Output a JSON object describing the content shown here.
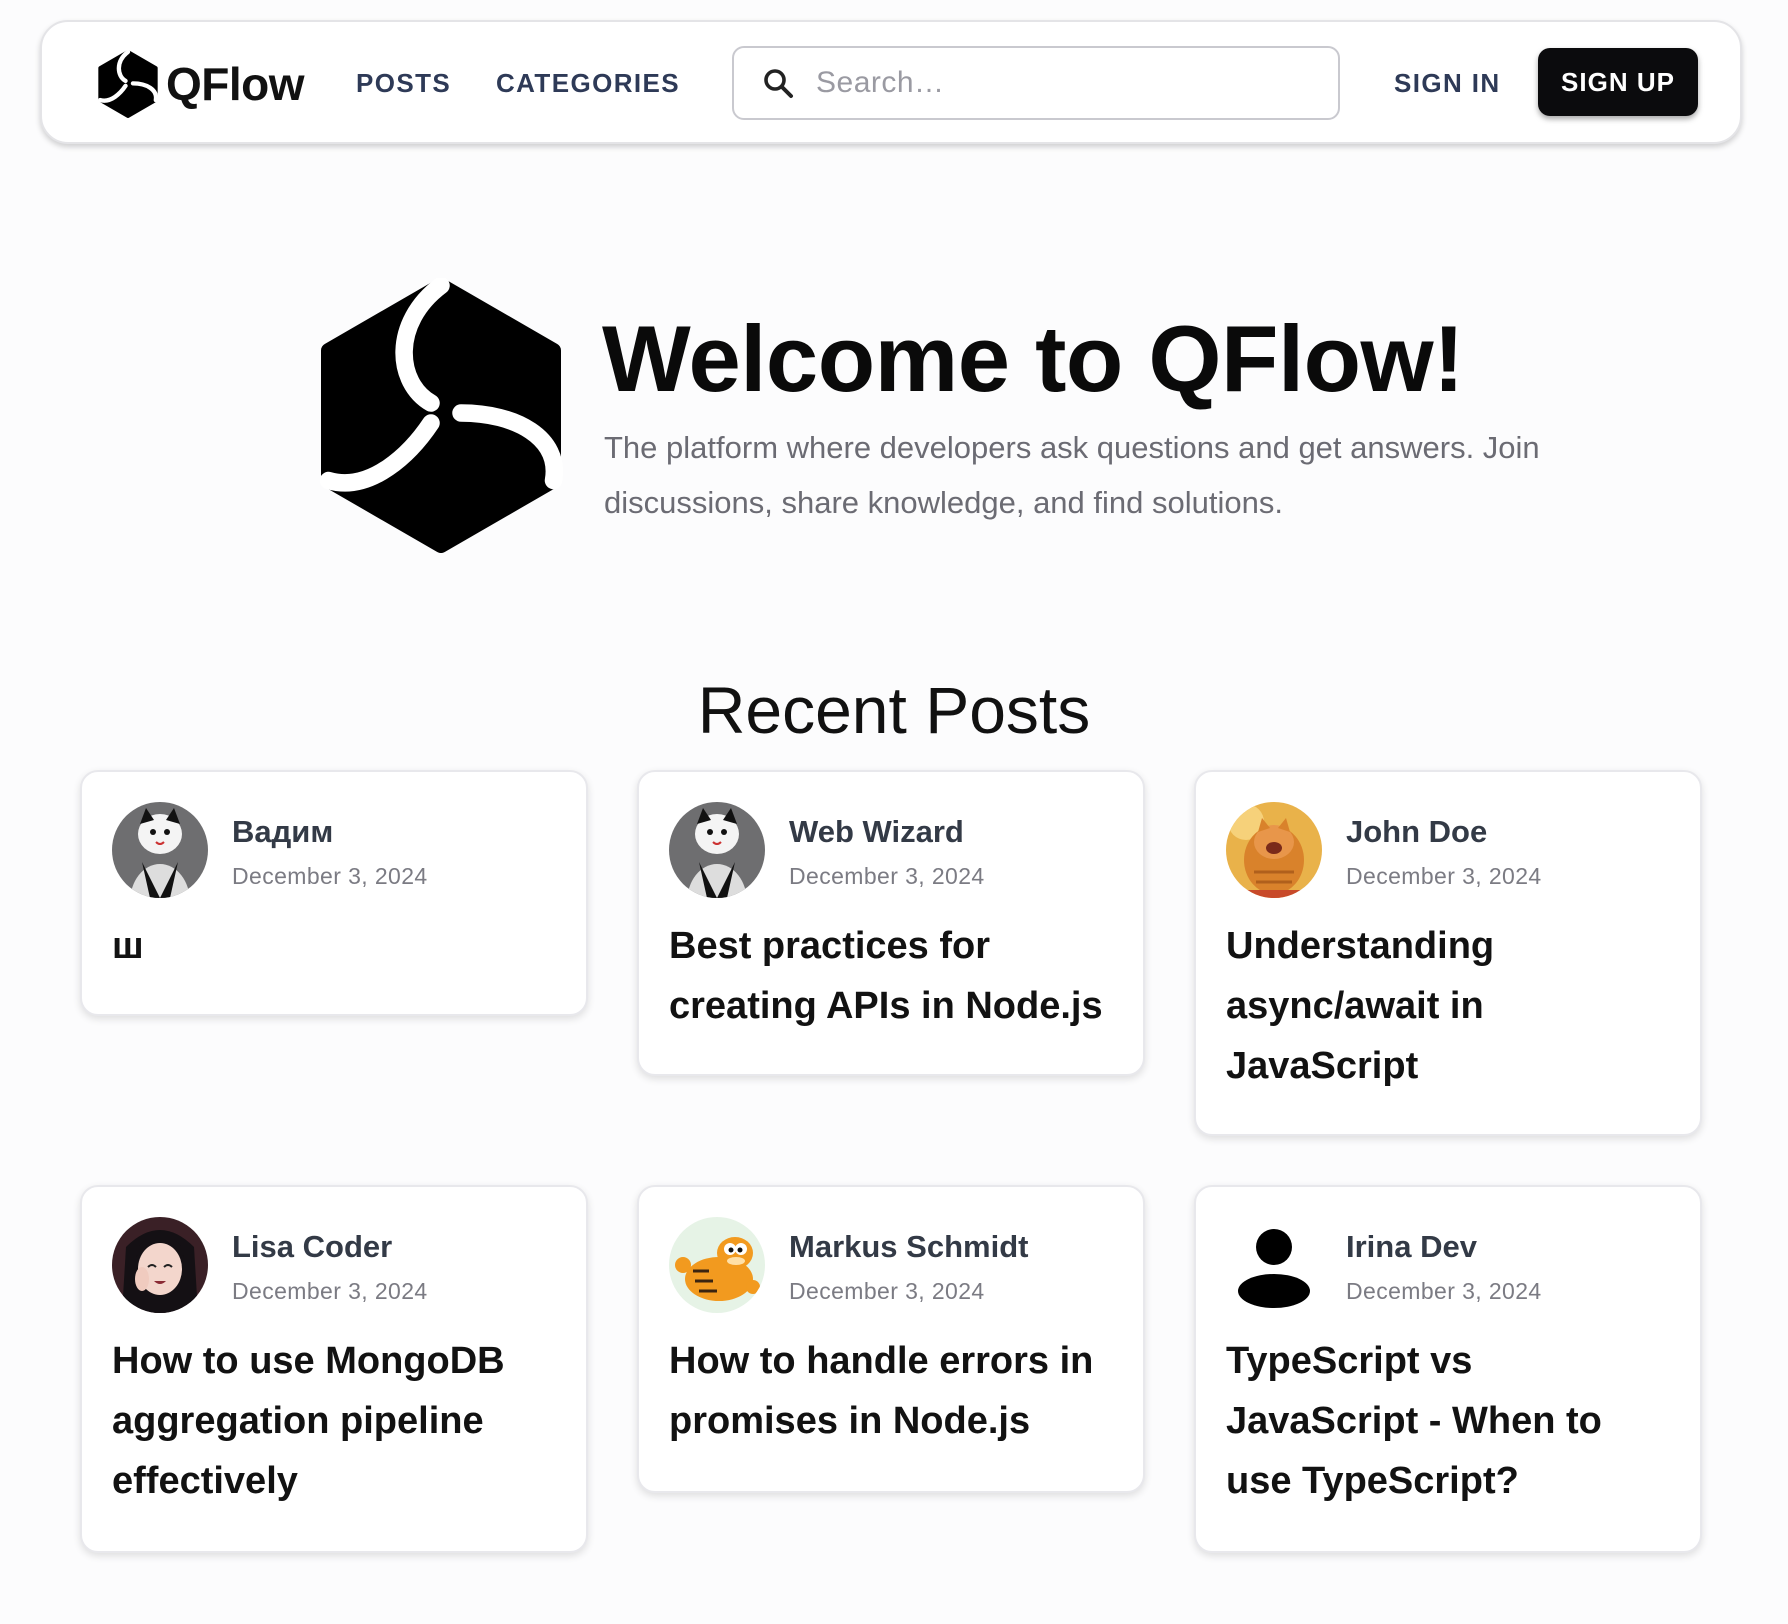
{
  "nav": {
    "brand": "QFlow",
    "links": [
      "Posts",
      "Categories"
    ],
    "search_placeholder": "Search…",
    "sign_in": "SIGN IN",
    "sign_up": "SIGN UP"
  },
  "hero": {
    "title": "Welcome to QFlow!",
    "subtitle": "The platform where developers ask questions and get answers. Join discussions, share knowledge, and find solutions."
  },
  "recent": {
    "title": "Recent Posts",
    "posts": [
      {
        "author": "Вадим",
        "date": "December 3, 2024",
        "title": "ш",
        "avatar": "cat-mask-avatar"
      },
      {
        "author": "Web Wizard",
        "date": "December 3, 2024",
        "title": "Best practices for creating APIs in Node.js",
        "avatar": "cat-mask-avatar"
      },
      {
        "author": "John Doe",
        "date": "December 3, 2024",
        "title": "Understanding async/await in JavaScript",
        "avatar": "orange-cat-avatar"
      },
      {
        "author": "Lisa Coder",
        "date": "December 3, 2024",
        "title": "How to use MongoDB aggregation pipeline effectively",
        "avatar": "anime-girl-avatar"
      },
      {
        "author": "Markus Schmidt",
        "date": "December 3, 2024",
        "title": "How to handle errors in promises in Node.js",
        "avatar": "garfield-avatar"
      },
      {
        "author": "Irina Dev",
        "date": "December 3, 2024",
        "title": "TypeScript vs JavaScript - When to use TypeScript?",
        "avatar": "person-silhouette-icon"
      }
    ]
  },
  "colors": {
    "accent_dark": "#0b0b0d",
    "nav_link": "#2e3a57",
    "muted_text": "#6b6b73"
  }
}
